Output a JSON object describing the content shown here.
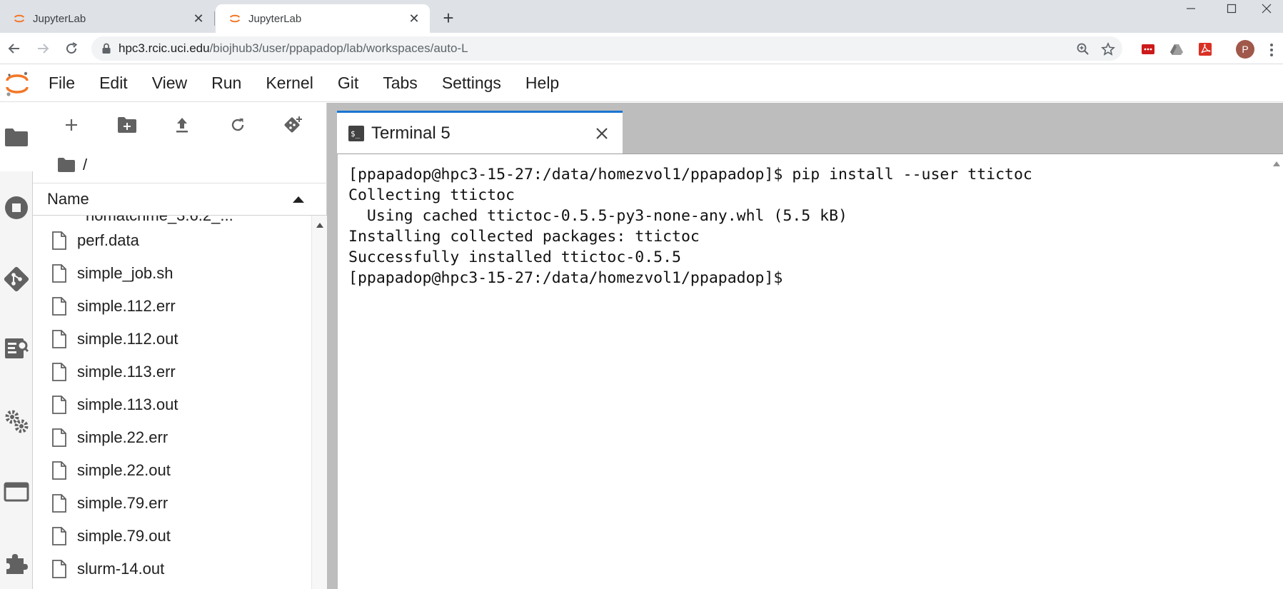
{
  "browser": {
    "tabs": [
      {
        "title": "JupyterLab",
        "active": false
      },
      {
        "title": "JupyterLab",
        "active": true
      }
    ],
    "url_host": "hpc3.rcic.uci.edu",
    "url_path": "/biojhub3/user/ppapadop/lab/workspaces/auto-L",
    "profile_initial": "P"
  },
  "menubar": {
    "items": [
      "File",
      "Edit",
      "View",
      "Run",
      "Kernel",
      "Git",
      "Tabs",
      "Settings",
      "Help"
    ]
  },
  "filebrowser": {
    "breadcrumb": "/",
    "column_header": "Name",
    "truncated_item": "nomatchme_3.6.2_...",
    "files": [
      "perf.data",
      "simple_job.sh",
      "simple.112.err",
      "simple.112.out",
      "simple.113.err",
      "simple.113.out",
      "simple.22.err",
      "simple.22.out",
      "simple.79.err",
      "simple.79.out",
      "slurm-14.out"
    ]
  },
  "main": {
    "tab_label": "Terminal 5",
    "terminal_lines": [
      "[ppapadop@hpc3-15-27:/data/homezvol1/ppapadop]$ pip install --user ttictoc",
      "Collecting ttictoc",
      "  Using cached ttictoc-0.5.5-py3-none-any.whl (5.5 kB)",
      "Installing collected packages: ttictoc",
      "Successfully installed ttictoc-0.5.5",
      "[ppapadop@hpc3-15-27:/data/homezvol1/ppapadop]$ "
    ]
  },
  "colors": {
    "jupyter_orange": "#f37626",
    "active_tab_accent": "#1976d2",
    "icon_gray": "#616161"
  }
}
